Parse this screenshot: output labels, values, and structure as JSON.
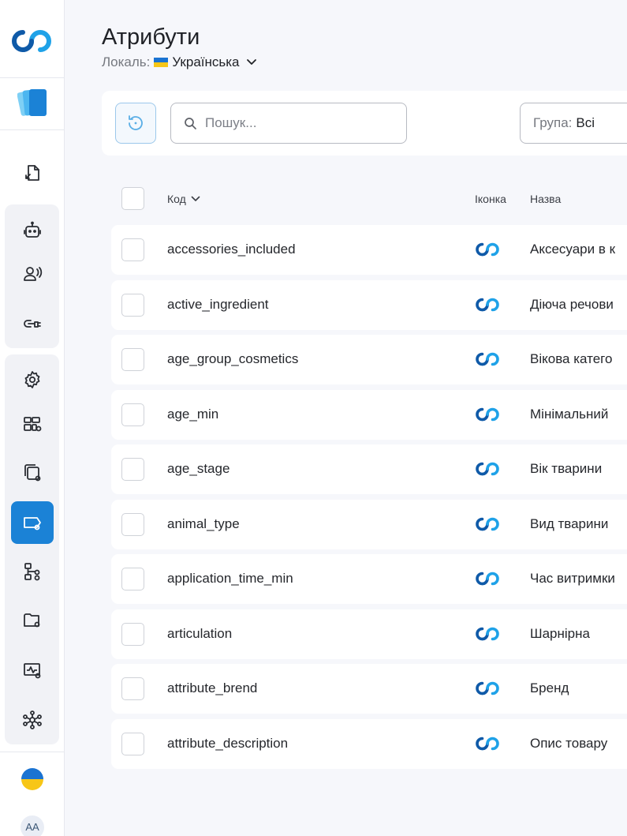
{
  "header": {
    "title": "Атрибути",
    "locale_label": "Локаль:",
    "locale_value": "Українська"
  },
  "toolbar": {
    "search_placeholder": "Пошук...",
    "group_label": "Група:",
    "group_value": "Всі"
  },
  "table": {
    "columns": {
      "code": "Код",
      "icon": "Іконка",
      "name": "Назва"
    },
    "rows": [
      {
        "code": "accessories_included",
        "name": "Аксесуари в к"
      },
      {
        "code": "active_ingredient",
        "name": "Діюча речови"
      },
      {
        "code": "age_group_cosmetics",
        "name": "Вікова катего"
      },
      {
        "code": "age_min",
        "name": "Мінімальний"
      },
      {
        "code": "age_stage",
        "name": "Вік тварини"
      },
      {
        "code": "animal_type",
        "name": "Вид тварини"
      },
      {
        "code": "application_time_min",
        "name": "Час витримки"
      },
      {
        "code": "articulation",
        "name": "Шарнірна"
      },
      {
        "code": "attribute_brend",
        "name": "Бренд"
      },
      {
        "code": "attribute_description",
        "name": "Опис товару"
      }
    ]
  },
  "sidebar": {
    "avatar_initials": "AA",
    "items": [
      "import-export-icon",
      "robot-icon",
      "voice-user-icon",
      "link-plug-icon",
      "settings-icon",
      "dashboard-settings-icon",
      "copy-settings-icon",
      "attributes-settings-icon",
      "hierarchy-settings-icon",
      "folder-settings-icon",
      "monitor-activity-icon",
      "network-icon"
    ],
    "active_item": "attributes-settings-icon"
  },
  "colors": {
    "accent": "#1b82d6",
    "logo_dark": "#0f5aa8",
    "logo_light": "#1fa2e8",
    "flag_blue": "#1a73d2",
    "flag_yellow": "#f7c617"
  }
}
